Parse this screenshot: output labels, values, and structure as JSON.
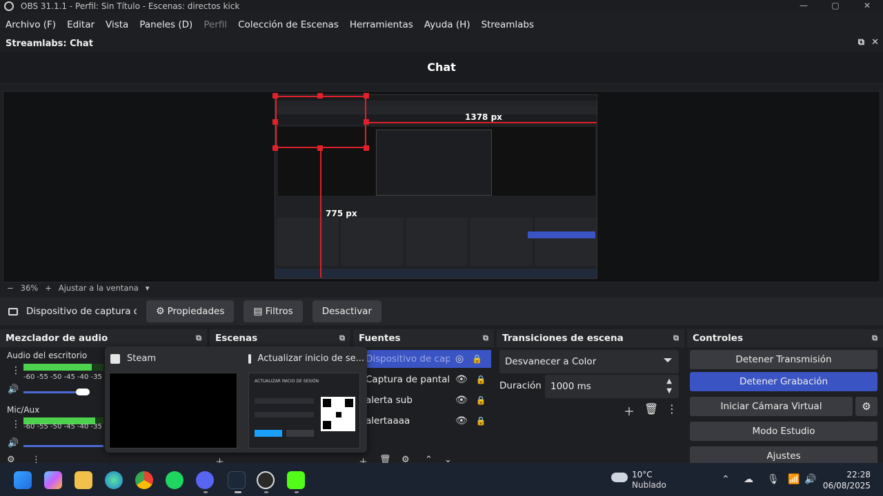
{
  "window": {
    "title": "OBS 31.1.1 - Perfil: Sin Título - Escenas: directos kick",
    "controls": [
      "—",
      "▢",
      "✕"
    ]
  },
  "menu": [
    "Archivo (F)",
    "Editar",
    "Vista",
    "Paneles (D)",
    "Perfil",
    "Colección de Escenas",
    "Herramientas",
    "Ayuda (H)",
    "Streamlabs"
  ],
  "dock_header": {
    "title": "Streamlabs: Chat"
  },
  "chat": {
    "title": "Chat"
  },
  "preview": {
    "width_label": "1378 px",
    "height_label": "775 px",
    "zoom": "36%",
    "fit_label": "Ajustar a la ventana"
  },
  "source_toolbar": {
    "source_name": "Dispositivo de captura de v",
    "properties": "Propiedades",
    "filters": "Filtros",
    "deactivate": "Desactivar"
  },
  "audio": {
    "title": "Mezclador de audio",
    "channels": [
      {
        "name": "Audio del escritorio",
        "scale": "-60 -55 -50 -45 -40 -35",
        "level": 0.85
      },
      {
        "name": "Mic/Aux",
        "scale": "-60 -55 -50 -45 -40 -35",
        "level": 0.9
      }
    ]
  },
  "scenes": {
    "title": "Escenas"
  },
  "sources": {
    "title": "Fuentes",
    "items": [
      {
        "name": "Dispositivo de cap",
        "selected": true
      },
      {
        "name": "Captura de pantall",
        "selected": false
      },
      {
        "name": "alerta sub",
        "selected": false
      },
      {
        "name": "alertaaaa",
        "selected": false
      }
    ]
  },
  "transitions": {
    "title": "Transiciones de escena",
    "selected": "Desvanecer a Color",
    "duration_label": "Duración",
    "duration_value": "1000 ms"
  },
  "controls": {
    "title": "Controles",
    "stop_stream": "Detener Transmisión",
    "stop_recording": "Detener Grabación",
    "virtual_camera": "Iniciar Cámara Virtual",
    "studio_mode": "Modo Estudio",
    "settings": "Ajustes"
  },
  "taskbar_popup": {
    "item1": "Steam",
    "item2": "Actualizar inicio de se...",
    "thumb2_heading": "ACTUALIZAR INICIO DE SESIÓN"
  },
  "weather": {
    "temp": "10°C",
    "condition": "Nublado"
  },
  "clock": {
    "time": "22:28",
    "date": "06/08/2025"
  },
  "colors": {
    "accent": "#3b54c4",
    "meter": "#4cd24c",
    "guide": "#e0202a"
  }
}
